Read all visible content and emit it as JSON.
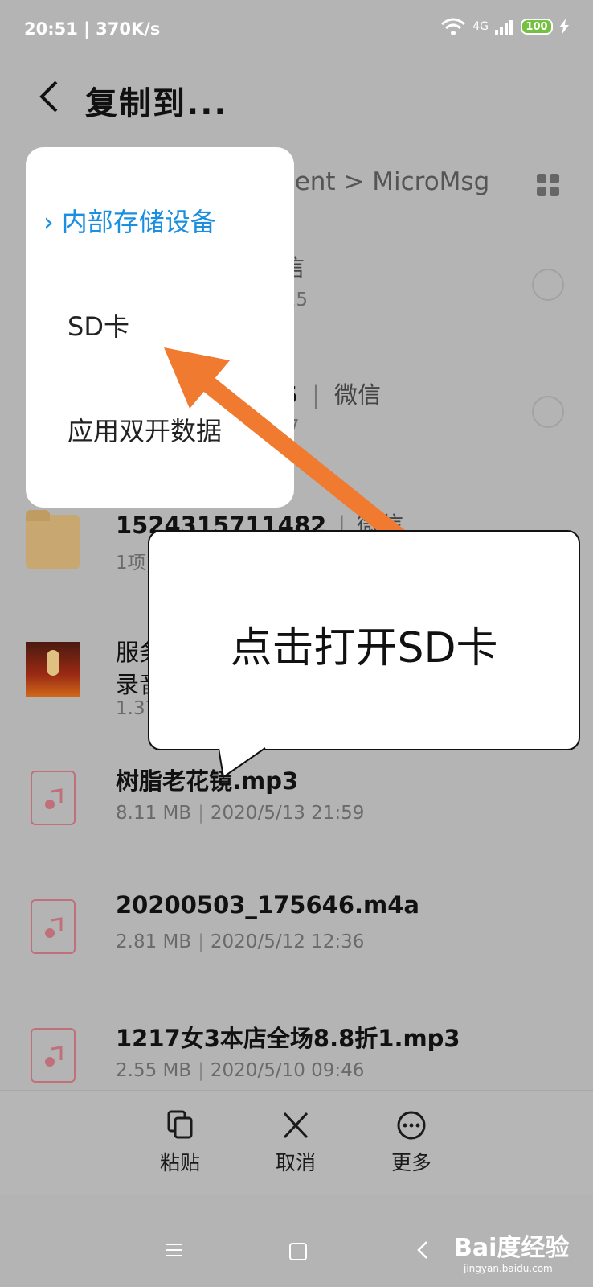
{
  "status": {
    "time": "20:51",
    "speed": "370K/s",
    "network": "4G",
    "battery": "100"
  },
  "header": {
    "title": "复制到..."
  },
  "breadcrumb": {
    "text": "ncent > MicroMsg"
  },
  "files": [
    {
      "name": "",
      "meta_left": "",
      "meta_right": "信",
      "sub": ":15",
      "type": "hidden"
    },
    {
      "name": "6",
      "meta_left": "",
      "meta_right": "微信",
      "sub": "7",
      "type": "hidden"
    },
    {
      "name": "1524315711482",
      "source": "微信",
      "meta": "1项",
      "type": "folder"
    },
    {
      "name": "服务",
      "line2": "录音",
      "meta": "1.37",
      "type": "cover"
    },
    {
      "name": "树脂老花镜.mp3",
      "size": "8.11 MB",
      "date": "2020/5/13 21:59",
      "type": "audio"
    },
    {
      "name": "20200503_175646.m4a",
      "size": "2.81 MB",
      "date": "2020/5/12 12:36",
      "type": "audio"
    },
    {
      "name": "1217女3本店全场8.8折1.mp3",
      "size": "2.55 MB",
      "date": "2020/5/10 09:46",
      "type": "audio"
    }
  ],
  "popup": {
    "items": [
      {
        "label": "内部存储设备",
        "active": true
      },
      {
        "label": "SD卡",
        "active": false
      },
      {
        "label": "应用双开数据",
        "active": false
      }
    ]
  },
  "callout": {
    "text": "点击打开SD卡"
  },
  "actions": [
    {
      "label": "粘贴",
      "icon": "paste-icon"
    },
    {
      "label": "取消",
      "icon": "close-icon"
    },
    {
      "label": "更多",
      "icon": "more-icon"
    }
  ],
  "watermark": {
    "brand": "Bai度经验",
    "url": "jingyan.baidu.com"
  },
  "colors": {
    "accent": "#1a8fe0",
    "arrow": "#f07a30",
    "overlay": "#b4b4b4"
  }
}
